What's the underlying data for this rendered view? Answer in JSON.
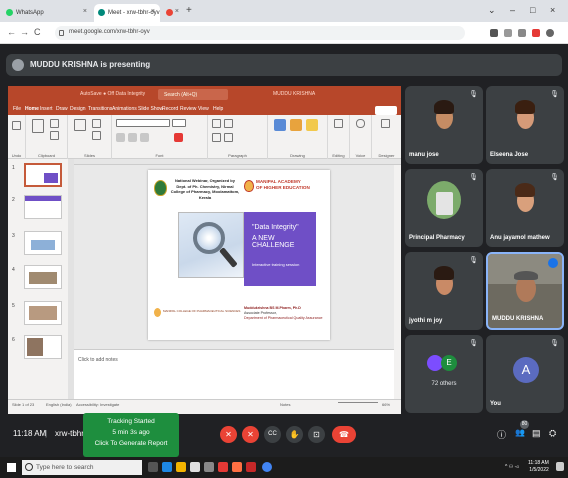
{
  "browser": {
    "tabs": [
      {
        "label": "WhatsApp",
        "active": false,
        "close": "×"
      },
      {
        "label": "Meet - xrw-tbhr-oyv",
        "active": true,
        "close": "×"
      },
      {
        "label": "",
        "active": false,
        "close": "×"
      }
    ],
    "new_tab": "+",
    "window_controls": [
      "⌄",
      "–",
      "□",
      "×"
    ],
    "nav": {
      "back": "←",
      "forward": "→",
      "reload": "C"
    },
    "url": "meet.google.com/xrw-tbhr-oyv"
  },
  "meet": {
    "presenting_text": "MUDDU KRISHNA is presenting",
    "participants": [
      {
        "name": "manu jose",
        "mic": "🎙"
      },
      {
        "name": "Elseena Jose",
        "mic": "🎙"
      },
      {
        "name": "Principal Pharmacy",
        "mic": "🎙"
      },
      {
        "name": "Anu jayamol mathew",
        "mic": "🎙"
      },
      {
        "name": "jyothi m joy",
        "mic": "🎙"
      },
      {
        "name": "MUDDU KRISHNA",
        "mic": ""
      },
      {
        "name": "",
        "mic": "🎙",
        "others_label": "72 others",
        "others_initial": "E"
      },
      {
        "name": "You",
        "mic": "🎙",
        "initial": "A"
      }
    ],
    "meeting_code": "xrw-tbhr-oyv",
    "time": "11:18 AM",
    "separator": "|",
    "tracking": {
      "line1": "Tracking Started",
      "line2": "5 min 3s ago",
      "line3": "Click To Generate Report"
    },
    "controls": {
      "mic": "✕",
      "camera": "✕",
      "captions": "CC",
      "raise_hand": "✋",
      "present": "⊡",
      "more": "⋮",
      "end": "☎"
    },
    "right_icons": {
      "info": "ⓘ",
      "people": "👥",
      "chat": "▤",
      "activities": "⛭"
    },
    "people_count": "80"
  },
  "powerpoint": {
    "title_left": "AutoSave  ● Off   Data Integrity",
    "search_placeholder": "Search (Alt+Q)",
    "user": "MUDDU KRISHNA",
    "menu": [
      "File",
      "Home",
      "Insert",
      "Draw",
      "Design",
      "Transitions",
      "Animations",
      "Slide Show",
      "Record",
      "Review",
      "View",
      "Help"
    ],
    "share": "Share",
    "ribbon_groups": [
      "Undo",
      "Clipboard",
      "Slides",
      "Font",
      "Paragraph",
      "Drawing",
      "Editing",
      "Voice",
      "Designer"
    ],
    "slide_numbers": [
      "1",
      "2",
      "3",
      "4",
      "5",
      "6"
    ],
    "notes_placeholder": "Click to add notes",
    "status": {
      "slide": "Slide 1 of 23",
      "lang": "English (India)",
      "access": "Accessibility: Investigate",
      "notes": "Notes",
      "zoom": "66%"
    },
    "slide": {
      "webinar": "National Webinar, Organized by Dept. of Ph. Chemistry, Nirmal College of Pharmacy, Moolamattom, Kerala",
      "mahe_line1": "MANIPAL ACADEMY",
      "mahe_line2": "OF HIGHER EDUCATION",
      "headline1": "\"Data Integrity\"",
      "headline2": "A NEW CHALLENGE",
      "subtitle": "Interactive training session",
      "footer_college": "MANIPAL COLLEGE OF PHARMACEUTICAL SCIENCES",
      "speaker_name": "Muddukrishna BS M.Pharm, Ph.D",
      "speaker_title": "Associate Professor,",
      "speaker_dept": "Department of Pharmaceutical Quality Assurance"
    }
  },
  "taskbar": {
    "search_placeholder": "Type here to search",
    "time": "11:18 AM",
    "date": "1/5/2022",
    "tray": "^ ⚇ ◅"
  },
  "colors": {
    "meet_bg": "#202124",
    "ppt_red": "#b7472a",
    "slide_purple": "#6f4fc6",
    "tracking_green": "#1e8e3e",
    "end_red": "#ea4335"
  }
}
